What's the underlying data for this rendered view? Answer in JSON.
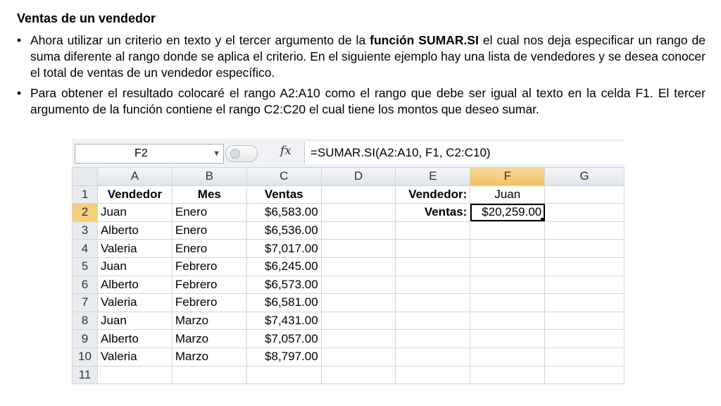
{
  "slide": {
    "title": "Ventas de un vendedor",
    "bullet_char": "•",
    "bullet1": {
      "pre": "Ahora utilizar un criterio en texto y el tercer argumento de la ",
      "bold": "función SUMAR.SI",
      "post": " el cual nos deja especificar un rango de suma diferente al rango donde se aplica el criterio. En el siguiente ejemplo hay una lista de vendedores y se desea conocer el total de ventas de un vendedor específico."
    },
    "bullet2": "Para obtener el resultado colocaré el rango A2:A10 como el rango que debe ser igual al texto en la celda F1. El tercer argumento de la función contiene el rango C2:C20 el cual tiene los montos que deseo sumar."
  },
  "excel": {
    "name_box": "F2",
    "fx_symbol": "fx",
    "formula": "=SUMAR.SI(A2:A10, F1, C2:C10)",
    "columns": [
      "A",
      "B",
      "C",
      "D",
      "E",
      "F",
      "G"
    ],
    "rows": [
      {
        "n": "1",
        "A": "Vendedor",
        "B": "Mes",
        "C": "Ventas",
        "D": "",
        "E": "Vendedor:",
        "F": "Juan",
        "G": ""
      },
      {
        "n": "2",
        "A": "Juan",
        "B": "Enero",
        "C": "$6,583.00",
        "D": "",
        "E": "Ventas:",
        "F": "$20,259.00",
        "G": ""
      },
      {
        "n": "3",
        "A": "Alberto",
        "B": "Enero",
        "C": "$6,536.00",
        "D": "",
        "E": "",
        "F": "",
        "G": ""
      },
      {
        "n": "4",
        "A": "Valeria",
        "B": "Enero",
        "C": "$7,017.00",
        "D": "",
        "E": "",
        "F": "",
        "G": ""
      },
      {
        "n": "5",
        "A": "Juan",
        "B": "Febrero",
        "C": "$6,245.00",
        "D": "",
        "E": "",
        "F": "",
        "G": ""
      },
      {
        "n": "6",
        "A": "Alberto",
        "B": "Febrero",
        "C": "$6,573.00",
        "D": "",
        "E": "",
        "F": "",
        "G": ""
      },
      {
        "n": "7",
        "A": "Valeria",
        "B": "Febrero",
        "C": "$6,581.00",
        "D": "",
        "E": "",
        "F": "",
        "G": ""
      },
      {
        "n": "8",
        "A": "Juan",
        "B": "Marzo",
        "C": "$7,431.00",
        "D": "",
        "E": "",
        "F": "",
        "G": ""
      },
      {
        "n": "9",
        "A": "Alberto",
        "B": "Marzo",
        "C": "$7,057.00",
        "D": "",
        "E": "",
        "F": "",
        "G": ""
      },
      {
        "n": "10",
        "A": "Valeria",
        "B": "Marzo",
        "C": "$8,797.00",
        "D": "",
        "E": "",
        "F": "",
        "G": ""
      },
      {
        "n": "11",
        "A": "",
        "B": "",
        "C": "",
        "D": "",
        "E": "",
        "F": "",
        "G": ""
      }
    ]
  }
}
